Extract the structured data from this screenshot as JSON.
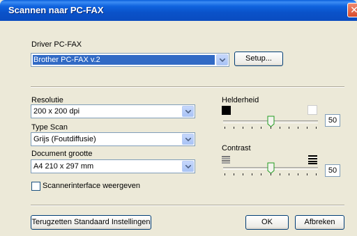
{
  "window": {
    "title": "Scannen naar PC-FAX",
    "close_glyph": "✕"
  },
  "driver": {
    "label": "Driver PC-FAX",
    "value": "Brother PC-FAX v.2",
    "setup_label": "Setup..."
  },
  "resolution": {
    "label": "Resolutie",
    "value": "200 x 200 dpi"
  },
  "scan_type": {
    "label": "Type Scan",
    "value": "Grijs (Foutdiffusie)"
  },
  "document_size": {
    "label": "Document grootte",
    "value": "A4 210 x 297 mm"
  },
  "scanner_interface": {
    "label": "Scannerinterface weergeven",
    "checked": false
  },
  "brightness": {
    "label": "Helderheid",
    "value": "50"
  },
  "contrast": {
    "label": "Contrast",
    "value": "50"
  },
  "footer": {
    "reset_label": "Terugzetten Standaard Instellingen",
    "ok_label": "OK",
    "cancel_label": "Afbreken"
  }
}
